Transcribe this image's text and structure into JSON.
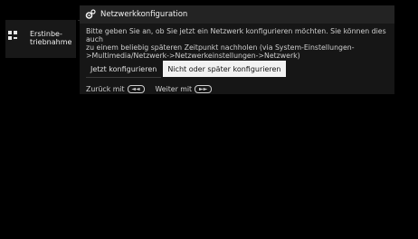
{
  "sidebar": {
    "label": "Erstinbe-\ntriebnahme",
    "icon": "setup-icon"
  },
  "panel": {
    "icon": "gears-icon",
    "title": "Netzwerkkonfiguration",
    "description": "Bitte geben Sie an, ob Sie jetzt ein Netzwerk konfigurieren möchten. Sie können dies auch\nzu einem beliebig späteren Zeitpunkt nachholen (via System-Einstellungen-\n>Multimedia/Netzwerk->Netzwerkeinstellungen->Netzwerk)",
    "options": [
      {
        "label": "Jetzt konfigurieren",
        "selected": false
      },
      {
        "label": "Nicht oder später konfigurieren",
        "selected": true
      }
    ],
    "nav": {
      "back_label": "Zurück mit",
      "back_key": "◄◄",
      "next_label": "Weiter mit",
      "next_key": "►►"
    }
  },
  "colors": {
    "background": "#000000",
    "panel": "#161616",
    "header": "#232323",
    "selected": "#f2f2f2"
  }
}
